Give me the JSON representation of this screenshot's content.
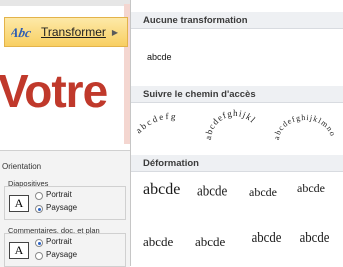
{
  "slide": {
    "title_text": "Votre"
  },
  "wordart_button": {
    "icon": "wordart-abc-icon",
    "label": "Transformer",
    "arrow": "submenu-arrow-icon"
  },
  "orientation": {
    "title": "Orientation",
    "slides_group": {
      "label": "Diapositives",
      "portrait": "Portrait",
      "landscape": "Paysage",
      "selected": "Paysage"
    },
    "notes_group": {
      "label": "Commentaires, doc. et plan",
      "portrait": "Portrait",
      "landscape": "Paysage",
      "selected": "Portrait"
    },
    "page_icon_letter": "A"
  },
  "gallery": {
    "no_transform": {
      "header": "Aucune transformation",
      "sample": "abcde"
    },
    "follow_path": {
      "header": "Suivre le chemin d'accès",
      "samples": [
        "abcdefg",
        "abcdefghijkl",
        "abcdefghijklmno"
      ]
    },
    "warp": {
      "header": "Déformation",
      "row1": [
        "abcde",
        "abcde",
        "abcde",
        "abcde"
      ],
      "row2": [
        "abcde",
        "abcde",
        "abcde",
        "abcde"
      ]
    }
  }
}
